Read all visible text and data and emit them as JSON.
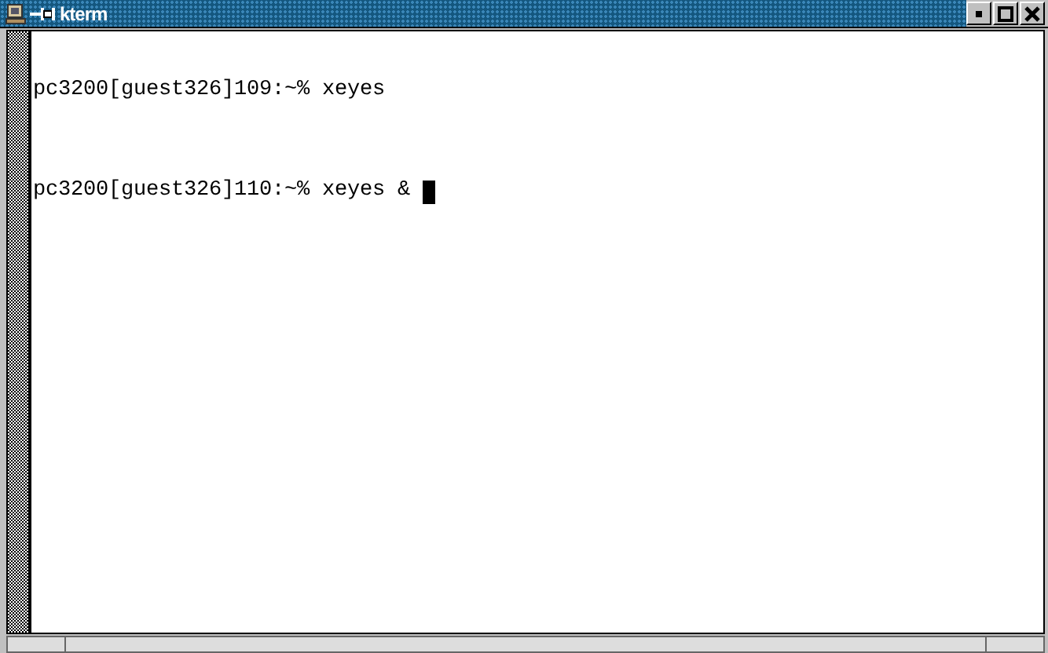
{
  "window": {
    "title": "kterm"
  },
  "terminal": {
    "lines": [
      {
        "text": "pc3200[guest326]109:~% xeyes",
        "cursor": false
      },
      {
        "text": "pc3200[guest326]110:~% xeyes & ",
        "cursor": true
      }
    ]
  }
}
